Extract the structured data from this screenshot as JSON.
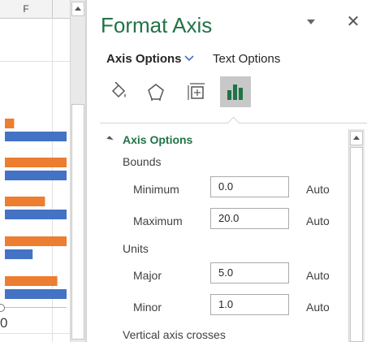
{
  "worksheet": {
    "column_header": "F",
    "axis_tick_label": "0"
  },
  "chart_data": {
    "type": "bar",
    "orientation": "horizontal",
    "series": [
      {
        "color": "#ed7d31",
        "values": [
          3,
          20,
          13,
          20,
          17
        ]
      },
      {
        "color": "#4472c4",
        "values": [
          20,
          20,
          20,
          9,
          20
        ]
      }
    ],
    "xlim": [
      0,
      20
    ]
  },
  "pane": {
    "title": "Format Axis",
    "tabs": {
      "axis_options": "Axis Options",
      "text_options": "Text Options"
    },
    "icons": [
      "fill-line-icon",
      "effects-icon",
      "size-properties-icon",
      "axis-options-chart-icon"
    ],
    "section": {
      "title": "Axis Options",
      "bounds_label": "Bounds",
      "minimum_label": "Minimum",
      "minimum_value": "0.0",
      "minimum_auto": "Auto",
      "maximum_label": "Maximum",
      "maximum_value": "20.0",
      "maximum_auto": "Auto",
      "units_label": "Units",
      "major_label": "Major",
      "major_value": "5.0",
      "major_auto": "Auto",
      "minor_label": "Minor",
      "minor_value": "1.0",
      "minor_auto": "Auto",
      "vertical_axis_crosses_label": "Vertical axis crosses"
    }
  },
  "colors": {
    "accent": "#217346",
    "orange": "#ed7d31",
    "blue": "#4472c4"
  }
}
